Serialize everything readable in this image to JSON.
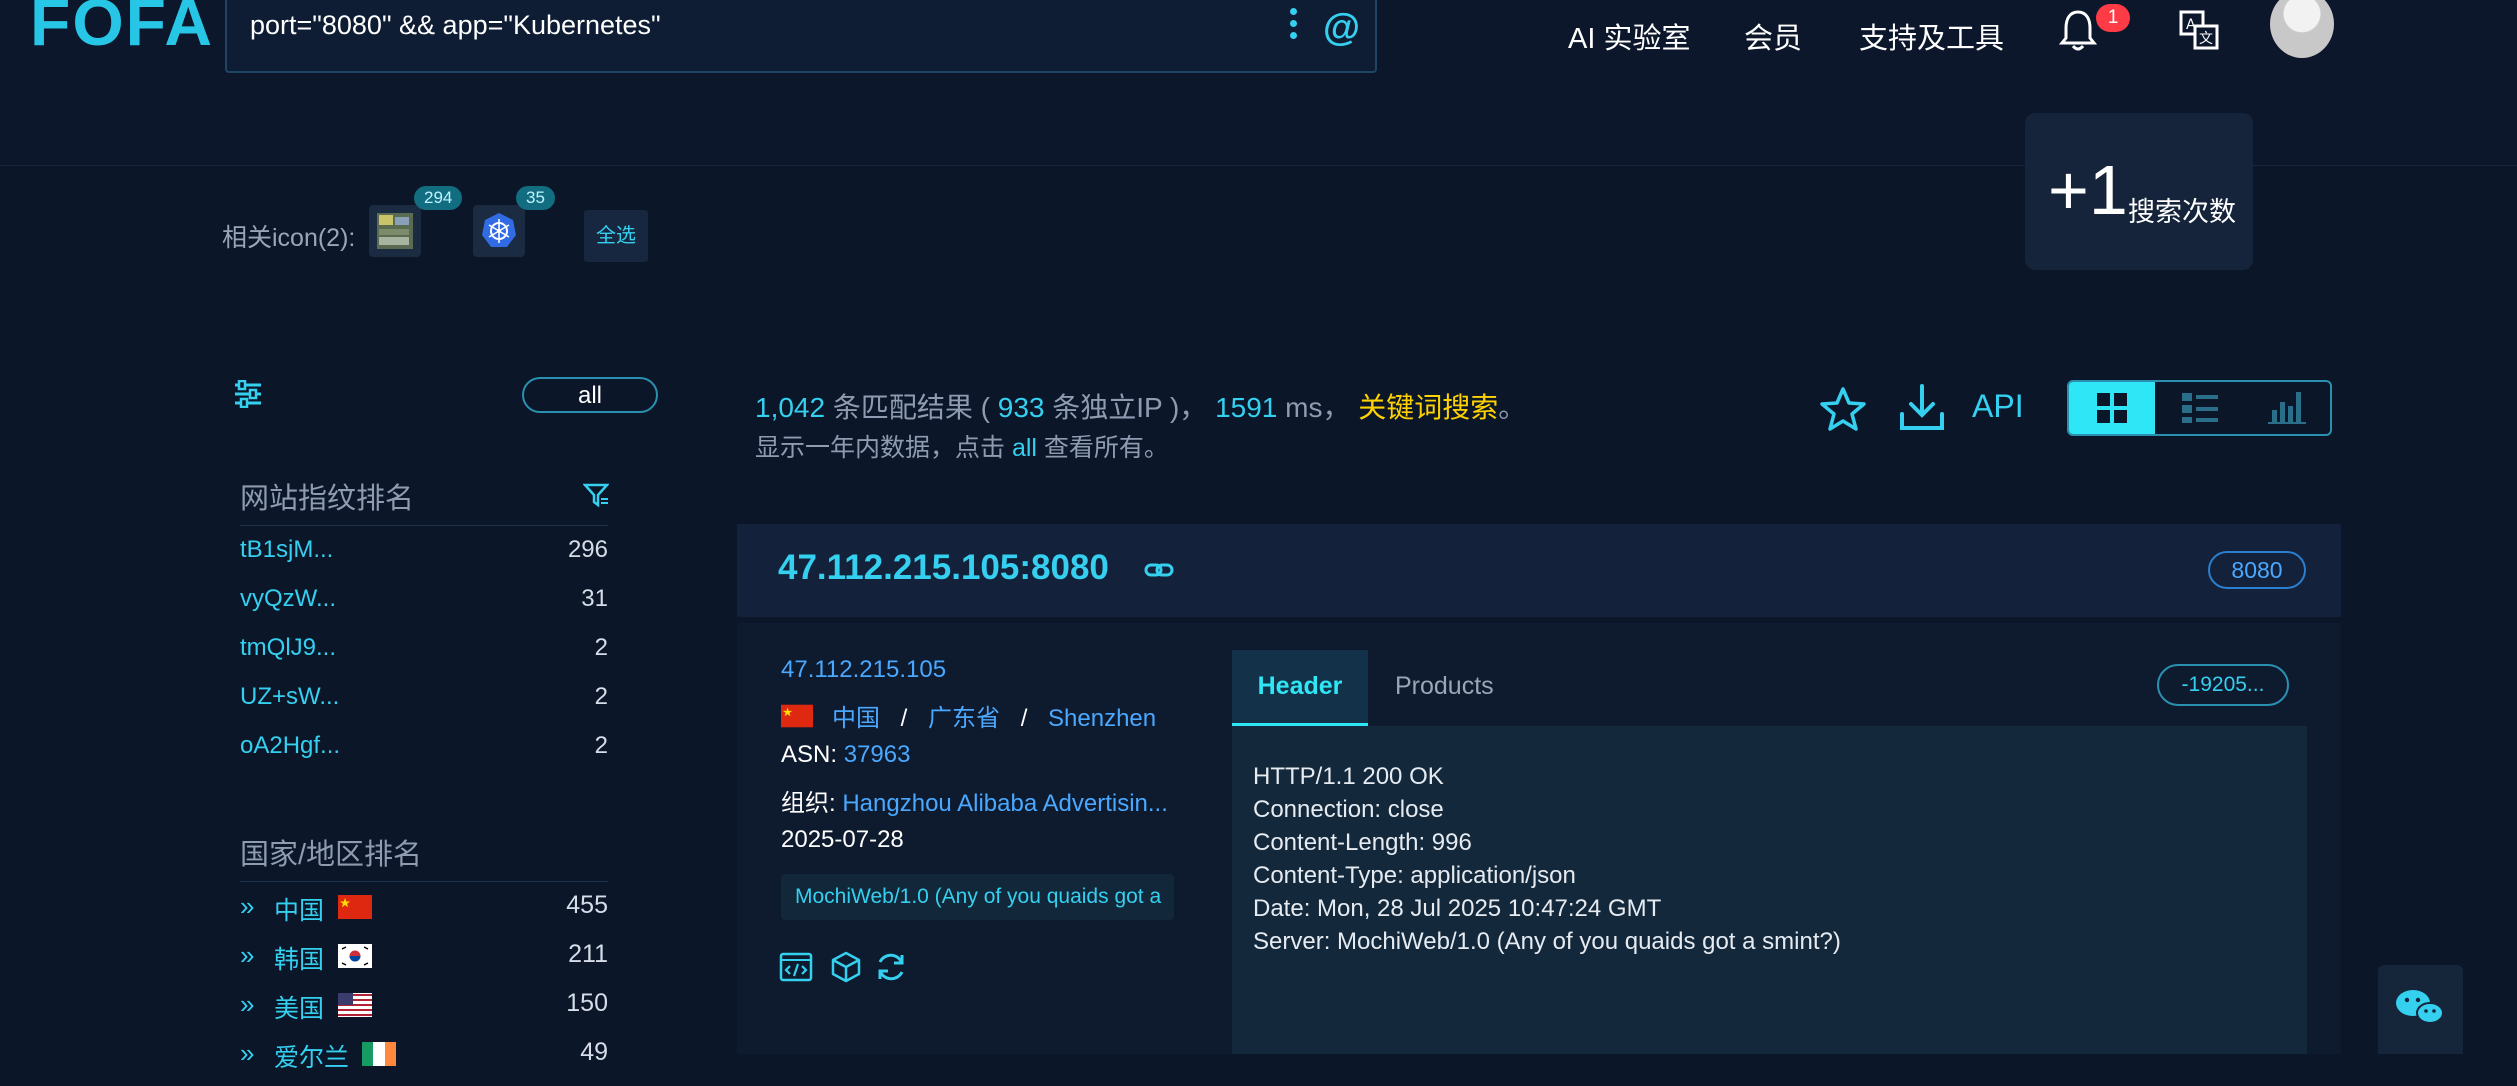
{
  "header": {
    "logo": "FOFA",
    "search_query": "port=\"8080\" && app=\"Kubernetes\"",
    "nav": [
      "AI 实验室",
      "会员",
      "支持及工具"
    ],
    "notification_count": "1"
  },
  "icons_row": {
    "label": "相关icon(2):",
    "icons": [
      {
        "count": "294"
      },
      {
        "count": "35"
      }
    ],
    "select_all": "全选"
  },
  "search_counter": {
    "plus": "+1",
    "label": "搜索次数"
  },
  "sidebar": {
    "all_label": "all",
    "fingerprint_title": "网站指纹排名",
    "fingerprints": [
      {
        "name": "tB1sjM...",
        "count": "296"
      },
      {
        "name": "vyQzW...",
        "count": "31"
      },
      {
        "name": "tmQlJ9...",
        "count": "2"
      },
      {
        "name": "UZ+sW...",
        "count": "2"
      },
      {
        "name": "oA2Hgf...",
        "count": "2"
      }
    ],
    "country_title": "国家/地区排名",
    "countries": [
      {
        "name": "中国",
        "count": "455"
      },
      {
        "name": "韩国",
        "count": "211"
      },
      {
        "name": "美国",
        "count": "150"
      },
      {
        "name": "爱尔兰",
        "count": "49"
      }
    ]
  },
  "summary": {
    "total": "1,042",
    "text1": " 条匹配结果 ( ",
    "unique_ip": "933",
    "text2": " 条独立IP )， ",
    "ms": "1591",
    "text3": " ms， ",
    "keyword": "关键词搜索",
    "dot": "。",
    "line2_a": "显示一年内数据，点击 ",
    "line2_all": "all",
    "line2_b": " 查看所有。",
    "api": "API"
  },
  "result": {
    "title": "47.112.215.105:8080",
    "port": "8080",
    "ip": "47.112.215.105",
    "country": "中国",
    "sep": "/",
    "province": "广东省",
    "city": "Shenzhen",
    "asn_label": "ASN: ",
    "asn": "37963",
    "org_label": "组织: ",
    "org": "Hangzhou Alibaba Advertisin...",
    "date": "2025-07-28",
    "server_tag": "MochiWeb/1.0 (Any of you quaids got a",
    "tabs": [
      "Header",
      "Products"
    ],
    "hash": "-19205...",
    "header_lines": [
      "HTTP/1.1 200 OK",
      "Connection: close",
      "Content-Length: 996",
      "Content-Type: application/json",
      "Date: Mon, 28 Jul 2025 10:47:24 GMT",
      "Server: MochiWeb/1.0 (Any of you quaids got a smint?)"
    ]
  }
}
